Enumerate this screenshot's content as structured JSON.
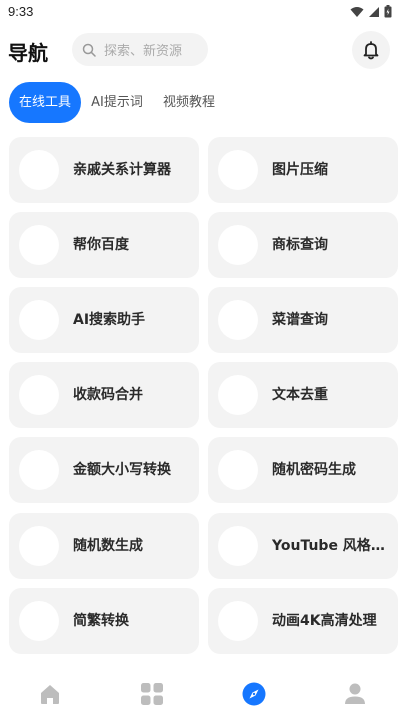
{
  "status_bar": {
    "time": "9:33"
  },
  "header": {
    "title": "导航",
    "search_placeholder": "探索、新资源"
  },
  "tabs": [
    {
      "label": "在线工具",
      "active": true
    },
    {
      "label": "AI提示词",
      "active": false
    },
    {
      "label": "视频教程",
      "active": false
    }
  ],
  "tools": [
    {
      "label": "亲戚关系计算器"
    },
    {
      "label": "图片压缩"
    },
    {
      "label": "帮你百度"
    },
    {
      "label": "商标查询"
    },
    {
      "label": "AI搜索助手"
    },
    {
      "label": "菜谱查询"
    },
    {
      "label": "收款码合并"
    },
    {
      "label": "文本去重"
    },
    {
      "label": "金额大小写转换"
    },
    {
      "label": "随机密码生成"
    },
    {
      "label": "随机数生成"
    },
    {
      "label": "YouTube 风格Lo..."
    },
    {
      "label": "简繁转换"
    },
    {
      "label": "动画4K高清处理"
    }
  ],
  "bottom_nav": [
    {
      "icon": "home-icon",
      "active": false
    },
    {
      "icon": "apps-grid-icon",
      "active": false
    },
    {
      "icon": "compass-icon",
      "active": true
    },
    {
      "icon": "profile-icon",
      "active": false
    }
  ],
  "colors": {
    "accent": "#1677ff",
    "card_bg": "#f3f3f3",
    "icon_gray": "#bdbdbd"
  }
}
